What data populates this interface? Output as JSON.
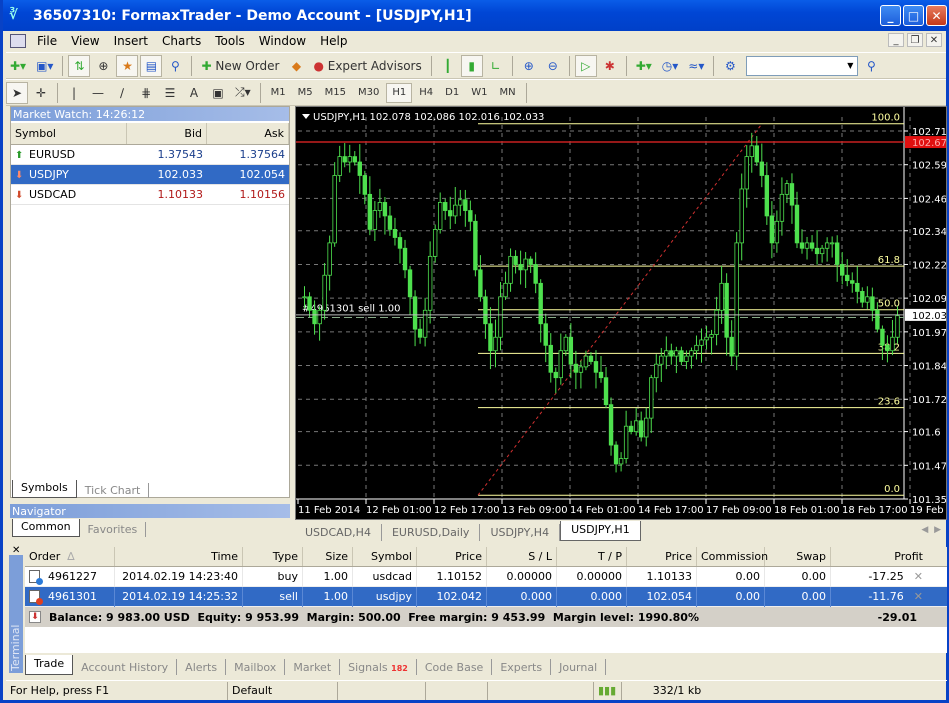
{
  "window": {
    "title": "36507310: FormaxTrader - Demo Account - [USDJPY,H1]"
  },
  "menu": [
    "File",
    "View",
    "Insert",
    "Charts",
    "Tools",
    "Window",
    "Help"
  ],
  "toolbar": {
    "new_order": "New Order",
    "expert_advisors": "Expert Advisors",
    "search_placeholder": ""
  },
  "timeframes": [
    "M1",
    "M5",
    "M15",
    "M30",
    "H1",
    "H4",
    "D1",
    "W1",
    "MN"
  ],
  "active_timeframe": "H1",
  "market_watch": {
    "title": "Market Watch: 14:26:12",
    "columns": [
      "Symbol",
      "Bid",
      "Ask"
    ],
    "rows": [
      {
        "symbol": "EURUSD",
        "bid": "1.37543",
        "ask": "1.37564",
        "dir": "up",
        "selected": false,
        "color": "#1a3e8c"
      },
      {
        "symbol": "USDJPY",
        "bid": "102.033",
        "ask": "102.054",
        "dir": "down",
        "selected": true,
        "color": "#ffffff"
      },
      {
        "symbol": "USDCAD",
        "bid": "1.10133",
        "ask": "1.10156",
        "dir": "down",
        "selected": false,
        "color": "#b01818"
      }
    ],
    "tabs": [
      "Symbols",
      "Tick Chart"
    ]
  },
  "navigator": {
    "title": "Navigator",
    "tabs": [
      "Common",
      "Favorites"
    ]
  },
  "chart": {
    "header": "USDJPY,H1  102.078 102.086 102.016 102.033",
    "order_label": "#4961301 sell 1.00",
    "price_labels": [
      "102.715",
      "102.590",
      "102.465",
      "102.345",
      "102.220",
      "102.095",
      "101.970",
      "101.845",
      "101.720",
      "101.600",
      "101.475",
      "101.350"
    ],
    "ask_line": "102.674",
    "bid_line": "102.033",
    "time_labels": [
      "11 Feb 2014",
      "12 Feb 01:00",
      "12 Feb 17:00",
      "13 Feb 09:00",
      "14 Feb 01:00",
      "14 Feb 17:00",
      "17 Feb 09:00",
      "18 Feb 01:00",
      "18 Feb 17:00",
      "19 Feb 09:00"
    ],
    "fibo_levels": [
      "100.0",
      "61.8",
      "50.0",
      "38.2",
      "23.6",
      "0.0"
    ],
    "tabs": [
      "USDCAD,H4",
      "EURUSD,Daily",
      "USDJPY,H4",
      "USDJPY,H1"
    ],
    "active_tab": "USDJPY,H1"
  },
  "chart_data": {
    "type": "candlestick",
    "title": "USDJPY,H1",
    "ohlc_header": {
      "open": 102.078,
      "high": 102.086,
      "low": 102.016,
      "close": 102.033
    },
    "ylim": [
      101.35,
      102.74
    ],
    "y_ticks": [
      102.715,
      102.59,
      102.465,
      102.345,
      102.22,
      102.095,
      101.97,
      101.845,
      101.72,
      101.6,
      101.475,
      101.35
    ],
    "x_ticks": [
      "11 Feb 2014",
      "12 Feb 01:00",
      "12 Feb 17:00",
      "13 Feb 09:00",
      "14 Feb 01:00",
      "14 Feb 17:00",
      "17 Feb 09:00",
      "18 Feb 01:00",
      "18 Feb 17:00",
      "19 Feb 09:00"
    ],
    "close_path": [
      102.1,
      102.05,
      102.0,
      102.05,
      102.18,
      102.3,
      102.55,
      102.62,
      102.6,
      102.62,
      102.6,
      102.55,
      102.48,
      102.35,
      102.42,
      102.45,
      102.4,
      102.35,
      102.32,
      102.28,
      102.2,
      102.1,
      101.98,
      101.95,
      102.05,
      102.25,
      102.35,
      102.45,
      102.42,
      102.4,
      102.44,
      102.46,
      102.42,
      102.38,
      102.2,
      102.1,
      102.0,
      101.9,
      101.95,
      102.1,
      102.15,
      102.25,
      102.22,
      102.2,
      102.24,
      102.22,
      102.15,
      102.0,
      101.92,
      101.82,
      101.8,
      101.9,
      101.95,
      101.85,
      101.82,
      101.84,
      101.88,
      101.86,
      101.82,
      101.8,
      101.7,
      101.55,
      101.48,
      101.5,
      101.62,
      101.6,
      101.64,
      101.58,
      101.65,
      101.8,
      101.85,
      101.88,
      101.9,
      101.88,
      101.9,
      101.86,
      101.88,
      101.9,
      101.92,
      101.94,
      101.95,
      101.96,
      102.05,
      102.15,
      101.95,
      101.88,
      102.3,
      102.5,
      102.62,
      102.66,
      102.6,
      102.55,
      102.4,
      102.3,
      102.38,
      102.48,
      102.52,
      102.44,
      102.3,
      102.28,
      102.3,
      102.28,
      102.26,
      102.28,
      102.3,
      102.3,
      102.22,
      102.18,
      102.16,
      102.15,
      102.12,
      102.08,
      102.1,
      102.05,
      101.98,
      101.92,
      101.9,
      101.95,
      102.03
    ],
    "ask_line": 102.674,
    "bid_line": 102.033,
    "order_line": {
      "label": "#4961301 sell 1.00",
      "price": 102.042
    },
    "fibonacci": [
      {
        "level": "100.0",
        "price": 102.742
      },
      {
        "level": "61.8",
        "price": 102.214
      },
      {
        "level": "50.0",
        "price": 102.052
      },
      {
        "level": "38.2",
        "price": 101.89
      },
      {
        "level": "23.6",
        "price": 101.689
      },
      {
        "level": "0.0",
        "price": 101.364
      }
    ],
    "grid": true
  },
  "terminal": {
    "side_label": "Terminal",
    "columns": [
      "Order",
      "Time",
      "Type",
      "Size",
      "Symbol",
      "Price",
      "S / L",
      "T / P",
      "Price",
      "Commission",
      "Swap",
      "Profit"
    ],
    "rows": [
      {
        "order": "4961227",
        "time": "2014.02.19 14:23:40",
        "type": "buy",
        "size": "1.00",
        "symbol": "usdcad",
        "price": "1.10152",
        "sl": "0.00000",
        "tp": "0.00000",
        "cur": "1.10133",
        "comm": "0.00",
        "swap": "0.00",
        "profit": "-17.25",
        "selected": false
      },
      {
        "order": "4961301",
        "time": "2014.02.19 14:25:32",
        "type": "sell",
        "size": "1.00",
        "symbol": "usdjpy",
        "price": "102.042",
        "sl": "0.000",
        "tp": "0.000",
        "cur": "102.054",
        "comm": "0.00",
        "swap": "0.00",
        "profit": "-11.76",
        "selected": true
      }
    ],
    "summary": "Balance: 9 983.00 USD  Equity: 9 953.99  Margin: 500.00  Free margin: 9 453.99  Margin level: 1990.80%",
    "total_profit": "-29.01",
    "tabs": [
      {
        "label": "Trade",
        "active": true
      },
      {
        "label": "Account History"
      },
      {
        "label": "Alerts"
      },
      {
        "label": "Mailbox"
      },
      {
        "label": "Market"
      },
      {
        "label": "Signals",
        "badge": "182"
      },
      {
        "label": "Code Base"
      },
      {
        "label": "Experts"
      },
      {
        "label": "Journal"
      }
    ]
  },
  "status": {
    "help": "For Help, press F1",
    "profile": "Default",
    "traffic": "332/1 kb"
  }
}
